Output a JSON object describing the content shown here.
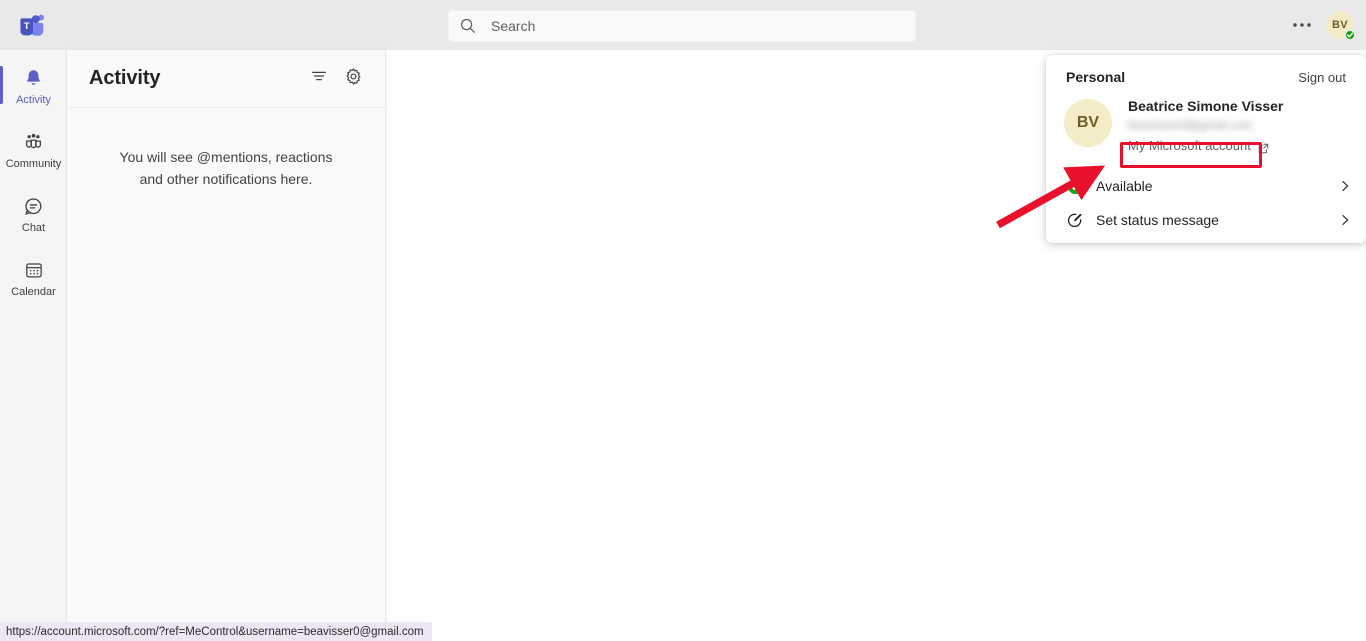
{
  "topbar": {
    "logo_name": "microsoft-teams-logo",
    "search": {
      "placeholder": "Search",
      "value": "",
      "icon": "search-icon"
    },
    "more_label": "•••",
    "avatar": {
      "initials": "BV",
      "presence": "Available",
      "presence_color": "#13a10e"
    }
  },
  "rail": {
    "items": [
      {
        "label": "Activity",
        "icon": "bell-icon",
        "active": true
      },
      {
        "label": "Community",
        "icon": "people-icon",
        "active": false
      },
      {
        "label": "Chat",
        "icon": "chat-icon",
        "active": false
      },
      {
        "label": "Calendar",
        "icon": "calendar-icon",
        "active": false
      }
    ],
    "active_color": "#5b5fc7"
  },
  "pane": {
    "title": "Activity",
    "filter_label": "Filter",
    "settings_label": "Notification settings",
    "empty_line1": "You will see @mentions, reactions",
    "empty_line2": "and other notifications here."
  },
  "flyout": {
    "section_label": "Personal",
    "sign_out_label": "Sign out",
    "avatar_initials": "BV",
    "display_name": "Beatrice Simone Visser",
    "email_masked": "beavisser0@gmail.com",
    "account_link_label": "My Microsoft account",
    "status": {
      "current_label": "Available",
      "current_color": "#13a10e",
      "set_message_label": "Set status message"
    }
  },
  "annotations": {
    "highlight_color": "#e8102a",
    "arrow_color": "#e8102a",
    "highlight_target": "My Microsoft account"
  },
  "statusbar": {
    "url": "https://account.microsoft.com/?ref=MeControl&username=beavisser0@gmail.com"
  }
}
